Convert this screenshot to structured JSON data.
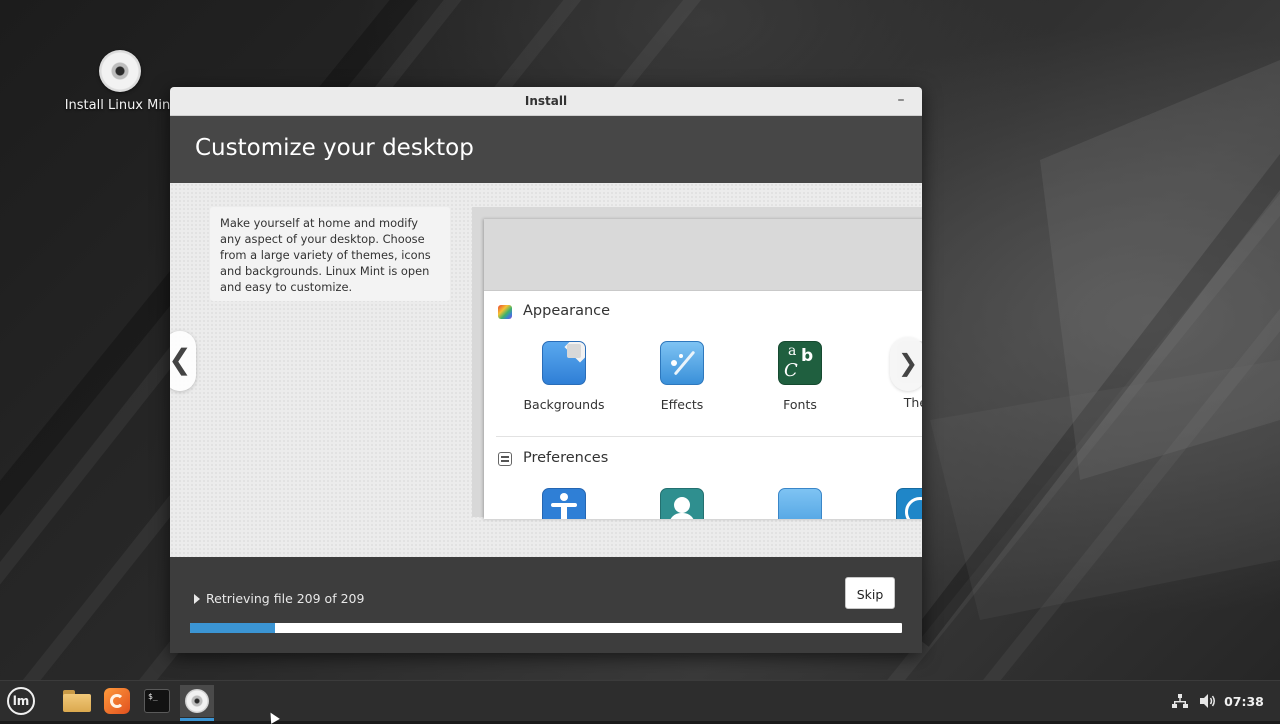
{
  "desktop": {
    "install_icon": {
      "label": "Install Linux Mint",
      "icon": "disc-icon"
    }
  },
  "window": {
    "title": "Install",
    "minimize_glyph": "–",
    "page_title": "Customize your desktop",
    "slide": {
      "description": "Make yourself at home and modify any aspect of your desktop. Choose from a large variety of themes, icons and backgrounds. Linux Mint is open and easy to customize.",
      "prev_glyph": "❮",
      "preview": {
        "next_glyph": "❯",
        "sections": [
          {
            "label": "Appearance",
            "icon": "appearance-icon",
            "tiles": [
              {
                "label": "Backgrounds",
                "icon": "backgrounds-icon"
              },
              {
                "label": "Effects",
                "icon": "effects-icon"
              },
              {
                "label": "Fonts",
                "icon": "fonts-icon"
              },
              {
                "label": "Ther",
                "icon": "themes-icon"
              }
            ]
          },
          {
            "label": "Preferences",
            "icon": "preferences-icon",
            "tiles": [
              {
                "label": "",
                "icon": "accessibility-icon"
              },
              {
                "label": "",
                "icon": "account-icon"
              },
              {
                "label": "",
                "icon": "applications-icon"
              },
              {
                "label": "",
                "icon": "date-time-icon"
              }
            ]
          }
        ],
        "fonts_glyph_top": "a",
        "fonts_glyph_b": "b",
        "fonts_glyph_c": "C"
      }
    },
    "progress": {
      "status": "Retrieving file 209 of 209",
      "fraction": 0.12,
      "skip_label": "Skip"
    }
  },
  "taskbar": {
    "menu_logo_text": "lm",
    "terminal_text": "$_",
    "clock": "07:38",
    "accent": "#3b95d4"
  }
}
